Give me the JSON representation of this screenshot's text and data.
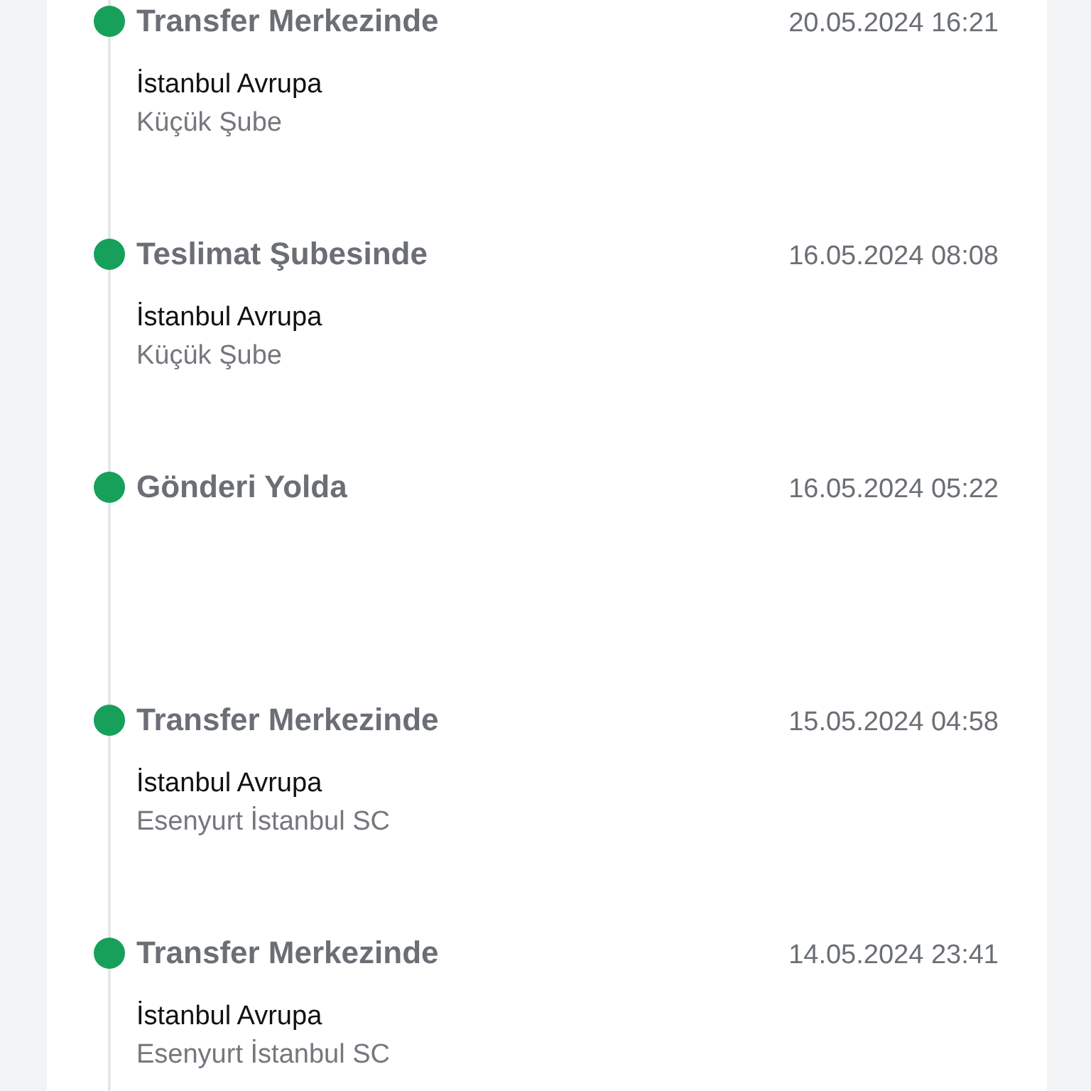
{
  "events": [
    {
      "status": "Transfer Merkezinde",
      "date": "20.05.2024 16:21",
      "location": "İstanbul Avrupa",
      "branch": "Küçük Şube",
      "completed": true
    },
    {
      "status": "Teslimat Şubesinde",
      "date": "16.05.2024 08:08",
      "location": "İstanbul Avrupa",
      "branch": "Küçük Şube",
      "completed": true
    },
    {
      "status": "Gönderi Yolda",
      "date": "16.05.2024 05:22",
      "completed": true
    },
    {
      "status": "Transfer Merkezinde",
      "date": "15.05.2024 04:58",
      "location": "İstanbul Avrupa",
      "branch": "Esenyurt İstanbul SC",
      "completed": true
    },
    {
      "status": "Transfer Merkezinde",
      "date": "14.05.2024 23:41",
      "location": "İstanbul Avrupa",
      "branch": "Esenyurt İstanbul SC",
      "completed": true
    }
  ]
}
